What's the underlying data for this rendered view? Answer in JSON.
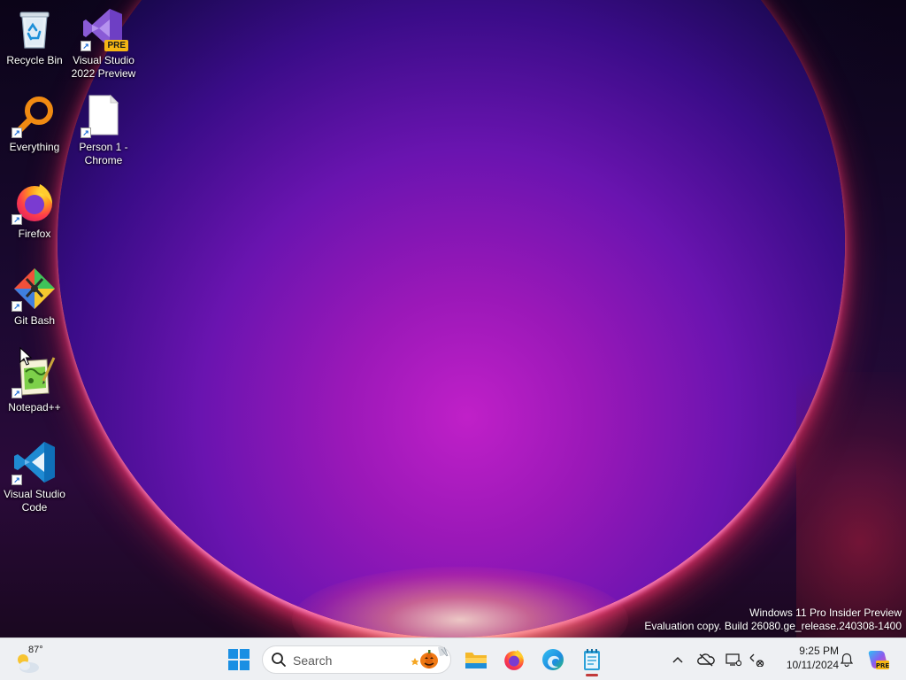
{
  "desktop": {
    "icons": [
      {
        "label": "Recycle Bin",
        "icon": "recycle-bin-icon",
        "shortcut": false
      },
      {
        "label": "Visual Studio\n2022 Preview",
        "icon": "visual-studio-preview-icon",
        "badge": "PRE",
        "shortcut": true
      },
      {
        "label": "Everything",
        "icon": "everything-search-icon",
        "shortcut": true
      },
      {
        "label": "Person 1 -\nChrome",
        "icon": "blank-document-icon",
        "shortcut": true
      },
      {
        "label": "Firefox",
        "icon": "firefox-icon",
        "shortcut": true
      },
      {
        "label": "Git Bash",
        "icon": "git-bash-icon",
        "shortcut": true
      },
      {
        "label": "Notepad++",
        "icon": "notepad-plus-plus-icon",
        "shortcut": true
      },
      {
        "label": "Visual Studio\nCode",
        "icon": "vscode-icon",
        "shortcut": true
      }
    ],
    "watermark": {
      "line1": "Windows 11 Pro Insider Preview",
      "line2": "Evaluation copy. Build 26080.ge_release.240308-1400"
    }
  },
  "taskbar": {
    "weather": {
      "temperature": "87°",
      "icon": "partly-cloudy-icon"
    },
    "start": {
      "icon": "windows-start-icon"
    },
    "search": {
      "placeholder": "Search",
      "icon": "search-icon",
      "decoration": "halloween-pumpkin-icon"
    },
    "pinned": [
      {
        "name": "File Explorer",
        "icon": "file-explorer-icon"
      },
      {
        "name": "Firefox",
        "icon": "firefox-icon"
      },
      {
        "name": "Microsoft Edge",
        "icon": "edge-icon"
      },
      {
        "name": "Notepad",
        "icon": "notepad-icon",
        "active": true
      }
    ],
    "tray": {
      "icons": [
        "chevron-up-icon",
        "onedrive-offline-icon",
        "display-settings-icon",
        "network-disconnected-icon"
      ],
      "time": "9:25 PM",
      "date": "10/11/2024",
      "notification_icon": "bell-icon",
      "copilot_icon": "copilot-preview-icon"
    }
  },
  "colors": {
    "taskbar_bg": "#eef0f3",
    "accent_blue": "#0078d4",
    "wallpaper_purple": "#9a18b8"
  }
}
